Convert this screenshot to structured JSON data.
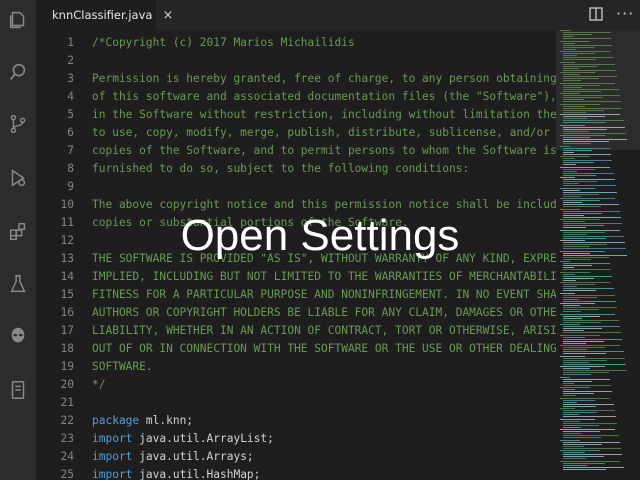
{
  "tab": {
    "filename": "knnClassifier.java",
    "close_glyph": "×"
  },
  "activity_bar": {
    "icons": [
      "explorer-icon",
      "search-icon",
      "source-control-icon",
      "debug-icon",
      "extensions-icon",
      "flask-icon",
      "alien-icon",
      "device-icon"
    ]
  },
  "editor": {
    "lines": [
      {
        "n": "1",
        "text": "/*Copyright (c) 2017 Marios Michailidis",
        "cls": "cm"
      },
      {
        "n": "2",
        "text": "",
        "cls": "cm"
      },
      {
        "n": "3",
        "text": "Permission is hereby granted, free of charge, to any person obtaining a copy",
        "cls": "cm"
      },
      {
        "n": "4",
        "text": "of this software and associated documentation files (the \"Software\"), to deal",
        "cls": "cm"
      },
      {
        "n": "5",
        "text": "in the Software without restriction, including without limitation the rights",
        "cls": "cm"
      },
      {
        "n": "6",
        "text": "to use, copy, modify, merge, publish, distribute, sublicense, and/or sell",
        "cls": "cm"
      },
      {
        "n": "7",
        "text": "copies of the Software, and to permit persons to whom the Software is",
        "cls": "cm"
      },
      {
        "n": "8",
        "text": "furnished to do so, subject to the following conditions:",
        "cls": "cm"
      },
      {
        "n": "9",
        "text": "",
        "cls": "cm"
      },
      {
        "n": "10",
        "text": "The above copyright notice and this permission notice shall be included in all",
        "cls": "cm"
      },
      {
        "n": "11",
        "text": "copies or substantial portions of the Software.",
        "cls": "cm"
      },
      {
        "n": "12",
        "text": "",
        "cls": "cm"
      },
      {
        "n": "13",
        "text": "THE SOFTWARE IS PROVIDED \"AS IS\", WITHOUT WARRANTY OF ANY KIND, EXPRESS OR",
        "cls": "cm"
      },
      {
        "n": "14",
        "text": "IMPLIED, INCLUDING BUT NOT LIMITED TO THE WARRANTIES OF MERCHANTABILITY,",
        "cls": "cm"
      },
      {
        "n": "15",
        "text": "FITNESS FOR A PARTICULAR PURPOSE AND NONINFRINGEMENT. IN NO EVENT SHALL THE",
        "cls": "cm"
      },
      {
        "n": "16",
        "text": "AUTHORS OR COPYRIGHT HOLDERS BE LIABLE FOR ANY CLAIM, DAMAGES OR OTHER",
        "cls": "cm"
      },
      {
        "n": "17",
        "text": "LIABILITY, WHETHER IN AN ACTION OF CONTRACT, TORT OR OTHERWISE, ARISING FROM,",
        "cls": "cm"
      },
      {
        "n": "18",
        "text": "OUT OF OR IN CONNECTION WITH THE SOFTWARE OR THE USE OR OTHER DEALINGS IN THE",
        "cls": "cm"
      },
      {
        "n": "19",
        "text": "SOFTWARE.",
        "cls": "cm"
      },
      {
        "n": "20",
        "text": "*/",
        "cls": "cm"
      },
      {
        "n": "21",
        "text": "",
        "cls": "tx"
      },
      {
        "n": "22",
        "kw": "package",
        "text": " ml.knn;",
        "cls": "tx"
      },
      {
        "n": "23",
        "kw": "import",
        "text": " java.util.ArrayList;",
        "cls": "tx"
      },
      {
        "n": "24",
        "kw": "import",
        "text": " java.util.Arrays;",
        "cls": "tx"
      },
      {
        "n": "25",
        "kw": "import",
        "text": " java.util.HashMap;",
        "cls": "tx"
      }
    ]
  },
  "overlay": {
    "caption": "Open Settings"
  },
  "colors": {
    "comment": "#6a9955",
    "keyword": "#569cd6",
    "text": "#d4d4d4",
    "line_number": "#858585",
    "tab_dot": "#e03030"
  }
}
